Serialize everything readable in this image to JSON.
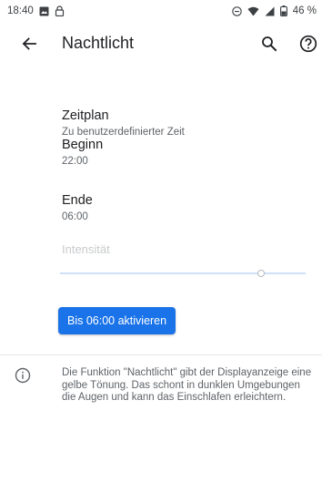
{
  "status_bar": {
    "time": "18:40",
    "battery_percent": "46 %",
    "icons": [
      "image-notification-icon",
      "lock-notification-icon",
      "do-not-disturb-icon",
      "wifi-icon",
      "cell-signal-icon",
      "battery-icon"
    ]
  },
  "app_bar": {
    "title": "Nachtlicht",
    "back_icon": "arrow-back-icon",
    "search_icon": "search-icon",
    "help_icon": "help-icon"
  },
  "preferences": [
    {
      "title": "Zeitplan",
      "summary": "Zu benutzerdefinierter Zeit"
    },
    {
      "title": "Beginn",
      "summary": "22:00"
    },
    {
      "title": "Ende",
      "summary": "06:00"
    }
  ],
  "intensity": {
    "label": "Intensität",
    "value_fraction": 0.82,
    "enabled": false
  },
  "activate_button": {
    "label": "Bis 06:00 aktivieren"
  },
  "footer": {
    "icon": "info-icon",
    "text": "Die Funktion \"Nachtlicht\" gibt der Displayanzeige eine gelbe Tönung. Das schont in dunklen Umgebungen die Augen und kann das Einschlafen erleichtern."
  },
  "colors": {
    "accent": "#1a73e8",
    "slider_track": "#cfe0f7",
    "disabled_text": "#c8cacc",
    "secondary_text": "#5f6368"
  }
}
